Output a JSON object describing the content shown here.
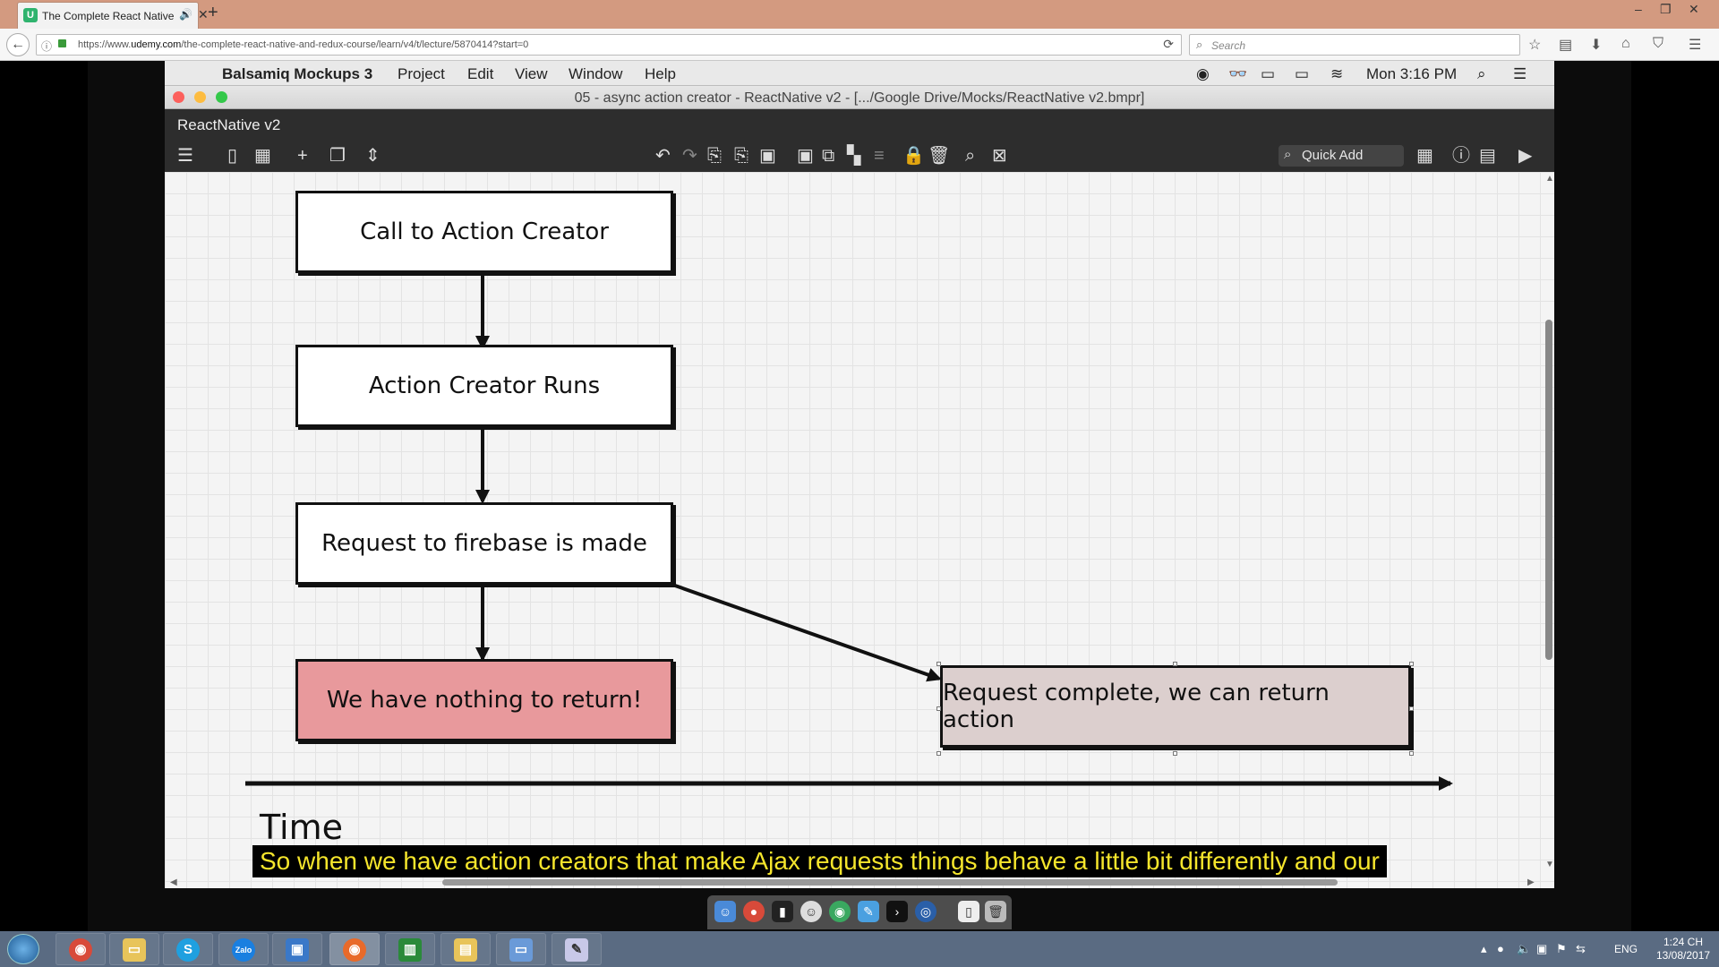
{
  "browser": {
    "tab_title": "The Complete React Native and Redux Course",
    "tab_favicon": "U",
    "url_domain_prefix": "https://www.",
    "url_domain": "udemy.com",
    "url_path": "/the-complete-react-native-and-redux-course/learn/v4/t/lecture/5870414?start=0",
    "search_placeholder": "Search"
  },
  "mac_menubar": {
    "app_name": "Balsamiq Mockups 3",
    "menus": [
      "Project",
      "Edit",
      "View",
      "Window",
      "Help"
    ],
    "clock": "Mon 3:16 PM"
  },
  "window": {
    "title": "05 - async action creator - ReactNative v2 - [.../Google Drive/Mocks/ReactNative v2.bmpr]",
    "project_name": "ReactNative v2",
    "quick_add_label": "Quick Add"
  },
  "diagram": {
    "box_call": "Call to Action Creator",
    "box_runs": "Action Creator Runs",
    "box_request": "Request to firebase is made",
    "box_nothing": "We have nothing to return!",
    "box_complete": "Request complete, we can return action",
    "time_label": "Time",
    "nothing_color": "#e8999c",
    "complete_color": "#dccfce"
  },
  "subtitle": "So when we have action creators that make Ajax requests things behave a little bit differently and our",
  "taskbar": {
    "apps": [
      "chrome-icon",
      "folder-icon",
      "skype-icon",
      "zalo-icon",
      "app-icon",
      "firefox-icon",
      "chart-icon",
      "explorer-icon",
      "screen-icon",
      "paint-icon"
    ],
    "zalo_label": "Zalo",
    "language": "ENG",
    "time": "1:24 CH",
    "date": "13/08/2017"
  }
}
